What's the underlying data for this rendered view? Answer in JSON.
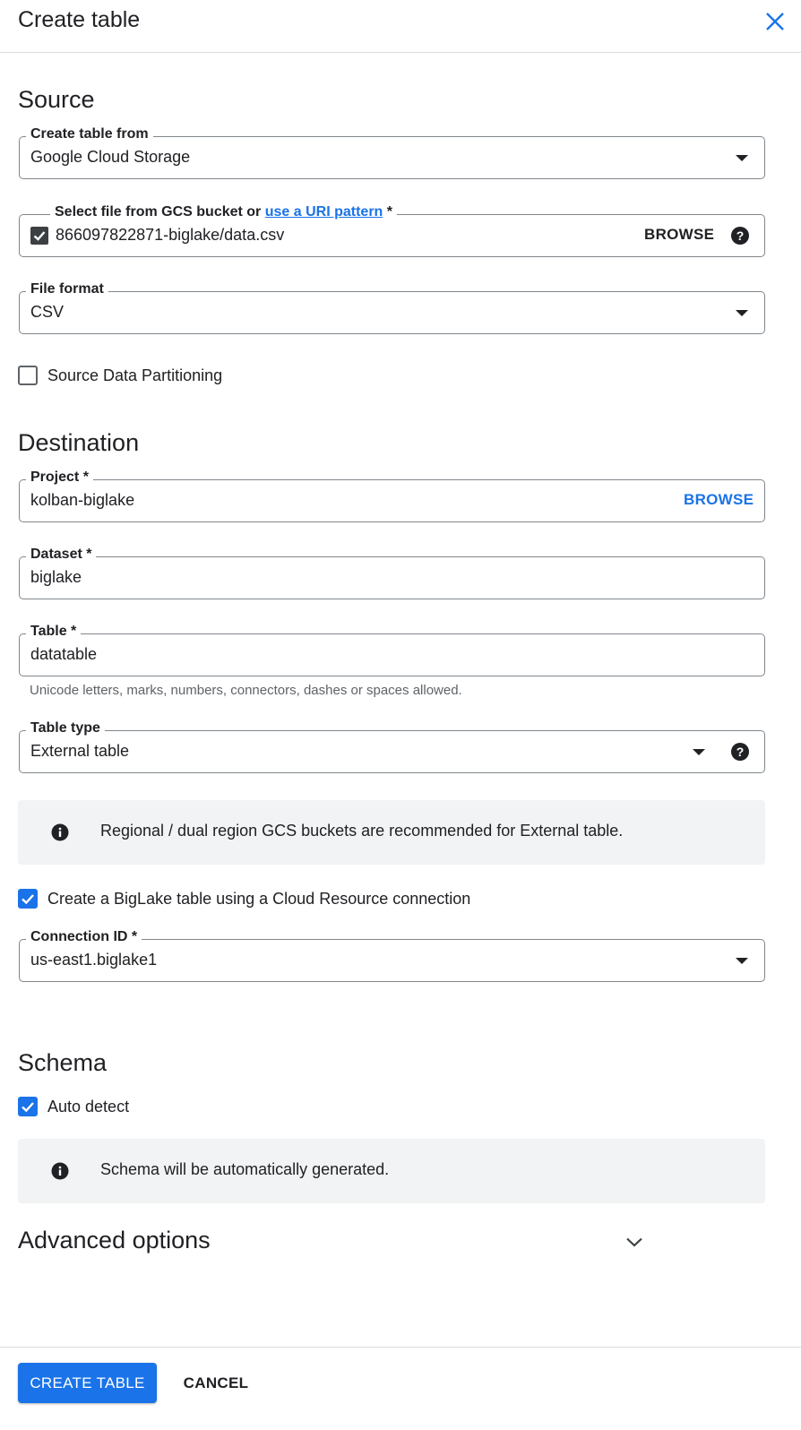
{
  "header": {
    "title": "Create table"
  },
  "source": {
    "title": "Source",
    "create_from": {
      "label": "Create table from",
      "value": "Google Cloud Storage"
    },
    "gcs_file": {
      "label_prefix": "Select file from GCS bucket or ",
      "label_link": "use a URI pattern",
      "label_suffix": " *",
      "value": "866097822871-biglake/data.csv",
      "browse_label": "BROWSE"
    },
    "file_format": {
      "label": "File format",
      "value": "CSV"
    },
    "partitioning": {
      "label": "Source Data Partitioning",
      "checked": false
    }
  },
  "destination": {
    "title": "Destination",
    "project": {
      "label": "Project *",
      "value": "kolban-biglake",
      "browse_label": "BROWSE"
    },
    "dataset": {
      "label": "Dataset *",
      "value": "biglake"
    },
    "table": {
      "label": "Table *",
      "value": "datatable",
      "hint": "Unicode letters, marks, numbers, connectors, dashes or spaces allowed."
    },
    "table_type": {
      "label": "Table type",
      "value": "External table"
    },
    "info": "Regional / dual region GCS buckets are recommended for External table.",
    "biglake": {
      "label": "Create a BigLake table using a Cloud Resource connection",
      "checked": true
    },
    "connection": {
      "label": "Connection ID *",
      "value": "us-east1.biglake1"
    }
  },
  "schema": {
    "title": "Schema",
    "auto_detect": {
      "label": "Auto detect",
      "checked": true
    },
    "info": "Schema will be automatically generated."
  },
  "advanced": {
    "label": "Advanced options"
  },
  "footer": {
    "create_label": "CREATE TABLE",
    "cancel_label": "CANCEL"
  },
  "colors": {
    "accent": "#1a73e8",
    "text": "#202124",
    "border": "#80868b",
    "info_bg": "#f1f3f4"
  }
}
